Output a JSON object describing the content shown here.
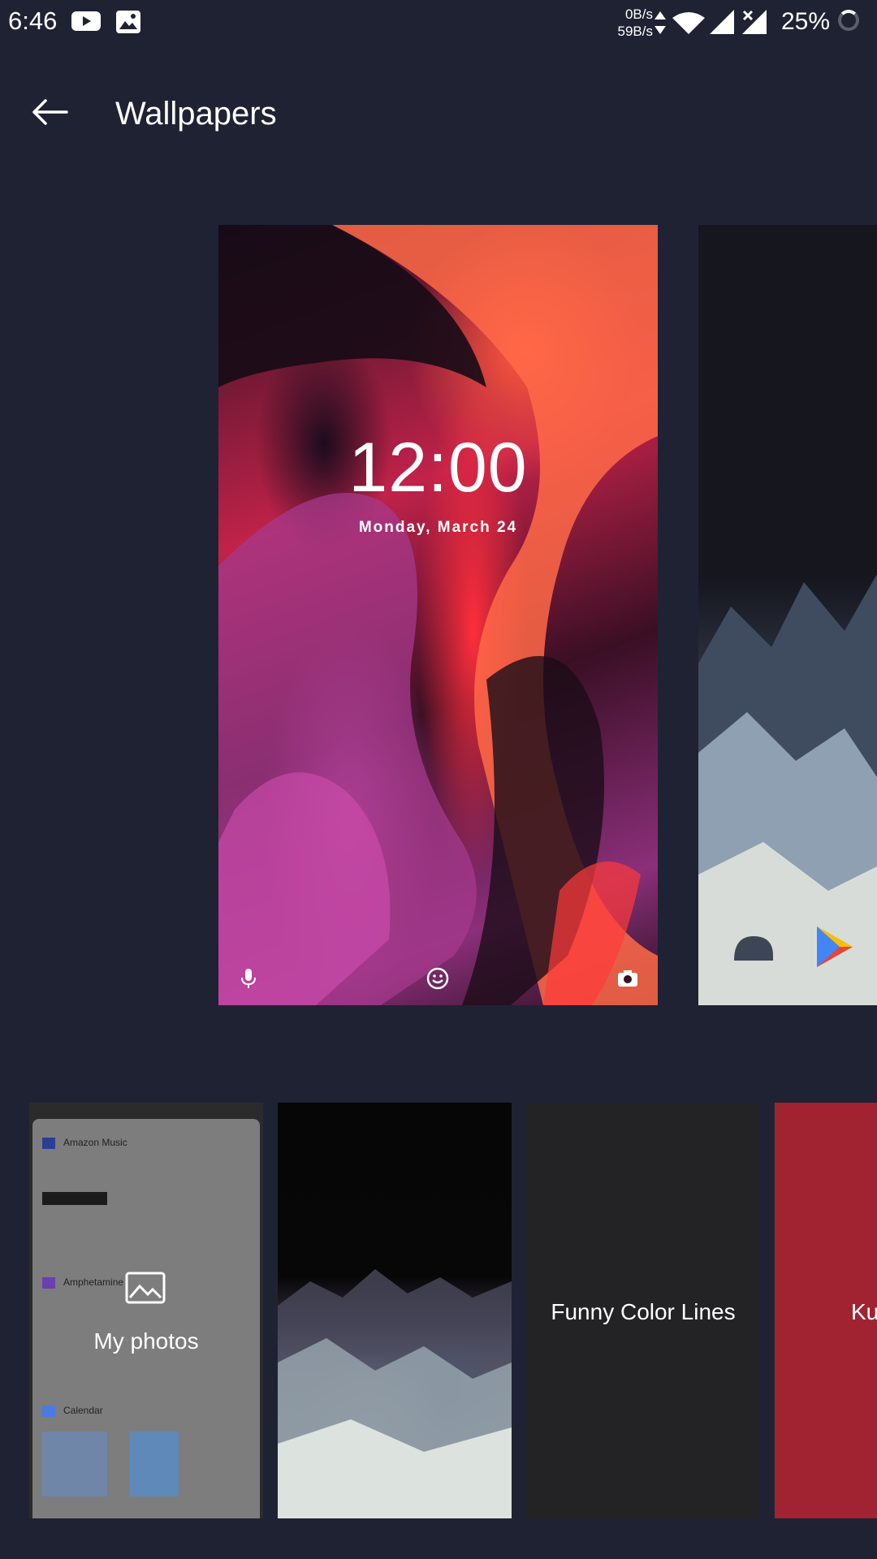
{
  "status_bar": {
    "time": "6:46",
    "net_up": "0B/s",
    "net_down": "59B/s",
    "battery": "25%"
  },
  "header": {
    "title": "Wallpapers",
    "back_icon": "arrow-back-icon"
  },
  "preview": {
    "clock": "12:00",
    "date": "Monday, March 24",
    "icons": [
      "mic-icon",
      "smiley-icon",
      "camera-icon"
    ]
  },
  "thumbnails": [
    {
      "label": "My photos",
      "icon": "image-icon",
      "mini_rows": [
        "Amazon Music",
        "Amphetamine",
        "Calendar"
      ]
    },
    {
      "label": ""
    },
    {
      "label": "Funny Color Lines"
    },
    {
      "label": "Ku"
    }
  ]
}
